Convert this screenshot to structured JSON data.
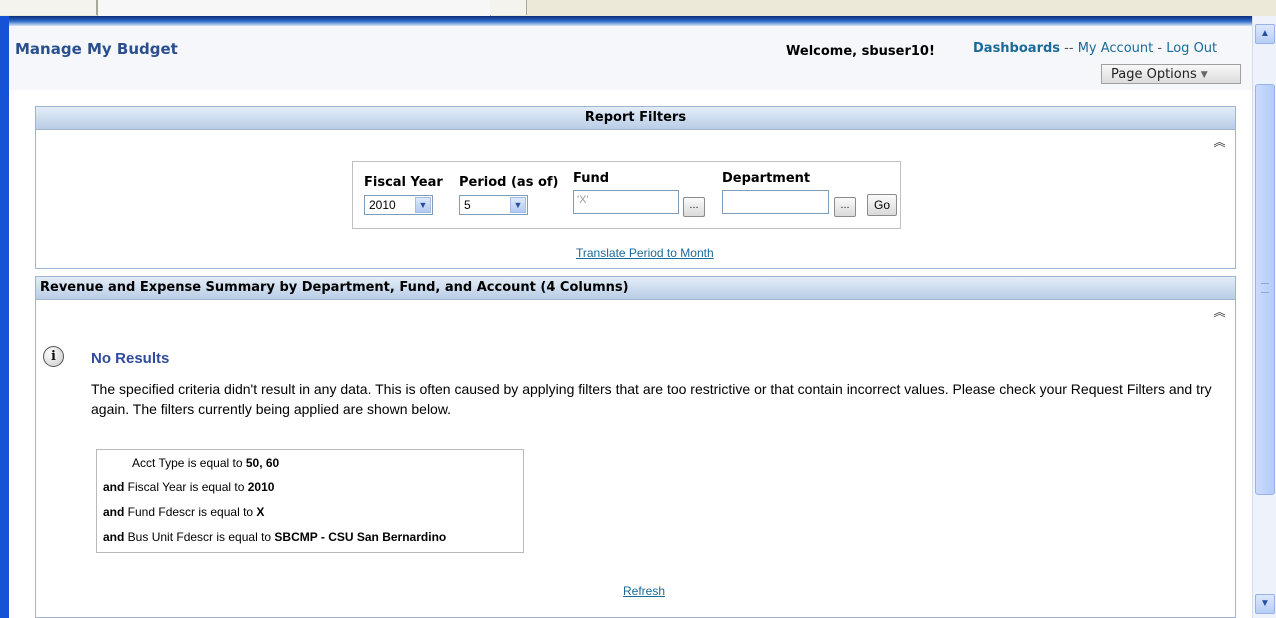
{
  "header": {
    "app_title": "Manage My Budget",
    "welcome": "Welcome, sbuser10!",
    "links": {
      "dashboards": "Dashboards",
      "sep1": "--",
      "my_account": "My Account",
      "sep2": "-",
      "log_out": "Log Out"
    },
    "page_options": "Page Options"
  },
  "filters": {
    "title": "Report Filters",
    "fiscal_year_label": "Fiscal Year",
    "fiscal_year_value": "2010",
    "period_label": "Period (as of)",
    "period_value": "5",
    "fund_label": "Fund",
    "fund_value": "'X'",
    "department_label": "Department",
    "department_value": "",
    "browse_label": "...",
    "go_label": "Go",
    "translate_link": "Translate Period to Month"
  },
  "summary": {
    "title": "Revenue and Expense Summary by Department, Fund, and Account (4 Columns)",
    "no_results_title": "No Results",
    "no_results_message": "The specified criteria didn't result in any data. This is often caused by applying filters that are too restrictive or that contain incorrect values. Please check your Request Filters and try again. The filters currently being applied are shown below.",
    "conditions": [
      {
        "prefix": "",
        "text": "Acct Type is equal to ",
        "value": "50, 60"
      },
      {
        "prefix": "and",
        "text": " Fiscal Year is equal to ",
        "value": "2010"
      },
      {
        "prefix": "and",
        "text": " Fund Fdescr is equal to ",
        "value": "X"
      },
      {
        "prefix": "and",
        "text": " Bus Unit Fdescr is equal to ",
        "value": "SBCMP - CSU San Bernardino"
      }
    ],
    "refresh_link": "Refresh"
  },
  "icons": {
    "collapse": "double-chevron-up-icon",
    "info": "info-icon",
    "dropdown": "chevron-down-icon",
    "scroll_up": "scroll-up-arrow-icon",
    "scroll_down": "scroll-down-arrow-icon"
  },
  "colors": {
    "title_blue": "#2a4f8f",
    "link": "#1a6a9a",
    "section_border": "#9fb4d1",
    "edge_blue": "#1652d6"
  }
}
